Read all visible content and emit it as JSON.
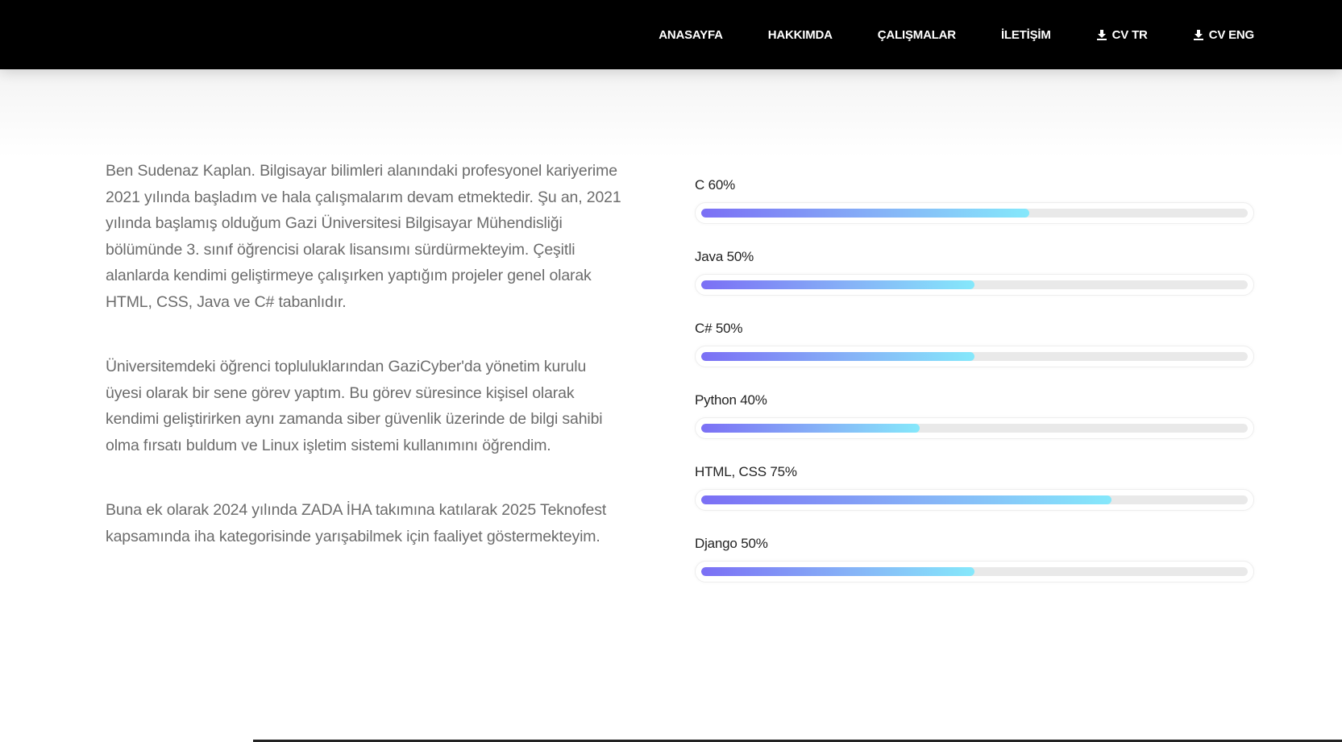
{
  "nav": {
    "links": [
      {
        "label": "ANASAYFA"
      },
      {
        "label": "HAKKIMDA"
      },
      {
        "label": "ÇALIŞMALAR"
      },
      {
        "label": "İLETİŞİM"
      },
      {
        "label": "CV TR",
        "icon": "download-icon"
      },
      {
        "label": "CV ENG",
        "icon": "download-icon"
      }
    ]
  },
  "about": {
    "paragraphs": [
      "Ben Sudenaz Kaplan. Bilgisayar bilimleri alanındaki profesyonel kariyerime 2021 yılında başladım ve hala çalışmalarım devam etmektedir. Şu an, 2021 yılında başlamış olduğum Gazi Üniversitesi Bilgisayar Mühendisliği bölümünde 3. sınıf öğrencisi olarak lisansımı sürdürmekteyim. Çeşitli alanlarda kendimi geliştirmeye çalışırken yaptığım projeler genel olarak HTML, CSS, Java ve C# tabanlıdır.",
      "Üniversitemdeki öğrenci topluluklarından GaziCyber'da yönetim kurulu üyesi olarak bir sene görev yaptım. Bu görev süresince kişisel olarak kendimi geliştirirken aynı zamanda siber güvenlik üzerinde de bilgi sahibi olma fırsatı buldum ve Linux işletim sistemi kullanımını öğrendim.",
      "Buna ek olarak 2024 yılında ZADA İHA takımına katılarak 2025 Teknofest kapsamında iha kategorisinde yarışabilmek için faaliyet göstermekteyim."
    ]
  },
  "skills": [
    {
      "label": "C 60%",
      "percent": 60
    },
    {
      "label": "Java 50%",
      "percent": 50
    },
    {
      "label": "C# 50%",
      "percent": 50
    },
    {
      "label": "Python 40%",
      "percent": 40
    },
    {
      "label": "HTML, CSS 75%",
      "percent": 75
    },
    {
      "label": "Django 50%",
      "percent": 50
    }
  ],
  "colors": {
    "navbar_bg": "#000000",
    "bar_gradient_start": "#7b6ff5",
    "bar_gradient_end": "#85e8fb",
    "rail": "#e9e9e9",
    "body_text": "#6c6c6c"
  }
}
